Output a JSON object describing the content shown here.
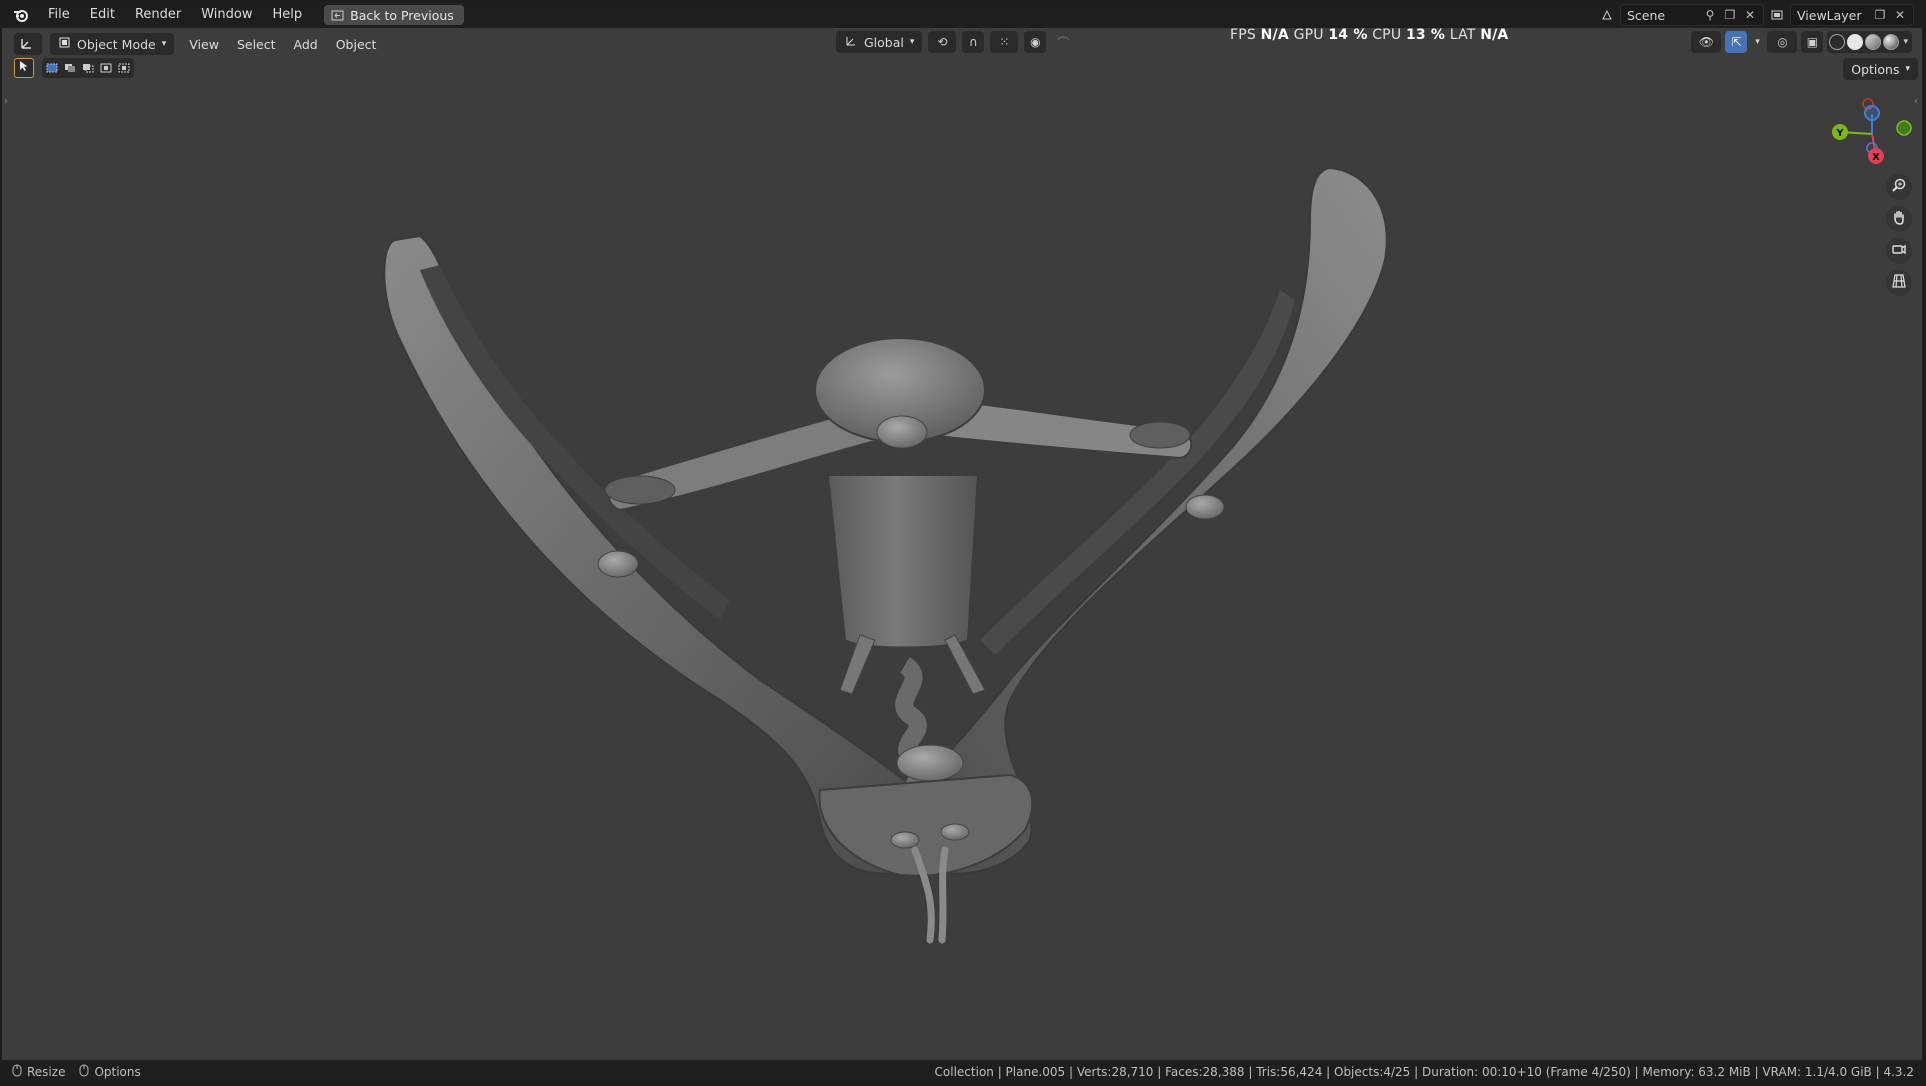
{
  "menubar": {
    "items": [
      "File",
      "Edit",
      "Render",
      "Window",
      "Help"
    ],
    "back_button": "Back to Previous",
    "scene_name": "Scene",
    "view_layer": "ViewLayer"
  },
  "viewport_header": {
    "mode": "Object Mode",
    "menus": [
      "View",
      "Select",
      "Add",
      "Object"
    ],
    "transform_orientation": "Global",
    "options_label": "Options"
  },
  "hud": {
    "fps_label": "FPS",
    "fps_value": "N/A",
    "gpu_label": "GPU",
    "gpu_value": "14 %",
    "cpu_label": "CPU",
    "cpu_value": "13 %",
    "lat_label": "LAT",
    "lat_value": "N/A"
  },
  "gizmo": {
    "x_label": "X",
    "y_label": "Y",
    "x_color": "#e0425a",
    "y_color": "#7fb51f",
    "z_color": "#3f7fd6"
  },
  "statusbar": {
    "left": [
      "Resize",
      "Options"
    ],
    "right": "Collection | Plane.005 | Verts:28,710 | Faces:28,388 | Tris:56,424 | Objects:4/25 | Duration: 00:10+10 (Frame 4/250) | Memory: 63.2 MiB | VRAM: 1.1/4.0 GiB | 4.3.2"
  },
  "icons": [
    "blender-logo-icon",
    "back-icon",
    "scene-icon",
    "pin-icon",
    "viewlayer-icon",
    "zoom-icon",
    "hand-icon",
    "camera-icon",
    "grid-icon"
  ]
}
